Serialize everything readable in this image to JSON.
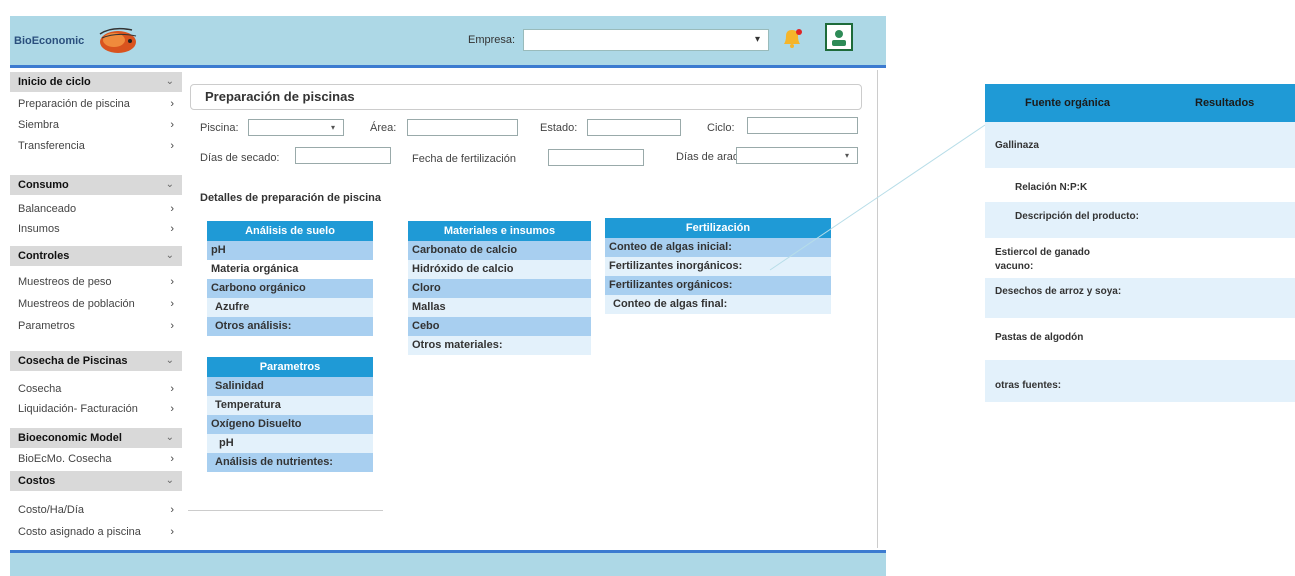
{
  "header": {
    "logo": "BioEconomic",
    "empresa_label": "Empresa:",
    "empresa_value": "",
    "colors": {
      "bar": "#add8e6",
      "accent": "#3c7bd0"
    },
    "icons": [
      "shrimp-logo-icon",
      "bell-icon",
      "user-icon",
      "chevron-down-icon"
    ]
  },
  "sidebar": {
    "sections": [
      {
        "label": "Inicio de ciclo",
        "items": [
          "Preparación de piscina",
          "Siembra",
          "Transferencia"
        ]
      },
      {
        "label": "Consumo",
        "items": [
          "Balanceado",
          "Insumos"
        ]
      },
      {
        "label": "Controles",
        "items": [
          "Muestreos de peso",
          "Muestreos de población",
          "Parametros"
        ]
      },
      {
        "label": "Cosecha de Piscinas",
        "items": [
          "Cosecha",
          "Liquidación- Facturación"
        ]
      },
      {
        "label": "Bioeconomic Model",
        "items": [
          "BioEcMo. Cosecha"
        ]
      },
      {
        "label": "Costos",
        "items": [
          "Costo/Ha/Día",
          "Costo asignado a piscina"
        ]
      }
    ],
    "chevron": "⌄",
    "arrow": "›"
  },
  "main": {
    "title": "Preparación de piscinas",
    "form": {
      "piscina_label": "Piscina:",
      "area_label": "Área:",
      "estado_label": "Estado:",
      "ciclo_label": "Ciclo:",
      "dias_secado_label": "Días de secado:",
      "fecha_label": "Fecha de fertilización",
      "dias_arado_label": "Días de arado:"
    },
    "details_title": "Detalles de preparación de piscina",
    "tables": {
      "suelo": {
        "header": "Análisis de suelo",
        "rows": [
          "pH",
          "Materia orgánica",
          "Carbono orgánico",
          "Azufre",
          "Otros análisis:"
        ]
      },
      "materiales": {
        "header": "Materiales e insumos",
        "rows": [
          "Carbonato de calcio",
          "Hidróxido de calcio",
          "Cloro",
          "Mallas",
          "Cebo",
          "Otros materiales:"
        ]
      },
      "fertilizacion": {
        "header": "Fertilización",
        "rows": [
          "Conteo de algas inicial:",
          "Fertilizantes inorgánicos:",
          "Fertilizantes orgánicos:",
          "Conteo de algas final:"
        ]
      },
      "parametros": {
        "header": "Parametros",
        "rows": [
          "Salinidad",
          "Temperatura",
          "Oxígeno Disuelto",
          "pH",
          "Análisis de nutrientes:"
        ]
      }
    }
  },
  "right_panel": {
    "col1": "Fuente orgánica",
    "col2": "Resultados",
    "rows": [
      "Gallinaza",
      "Relación N:P:K",
      "Descripción del producto:",
      "Estiercol de ganado vacuno:",
      "Desechos de arroz y soya:",
      "Pastas de algodón",
      "otras fuentes:"
    ]
  }
}
